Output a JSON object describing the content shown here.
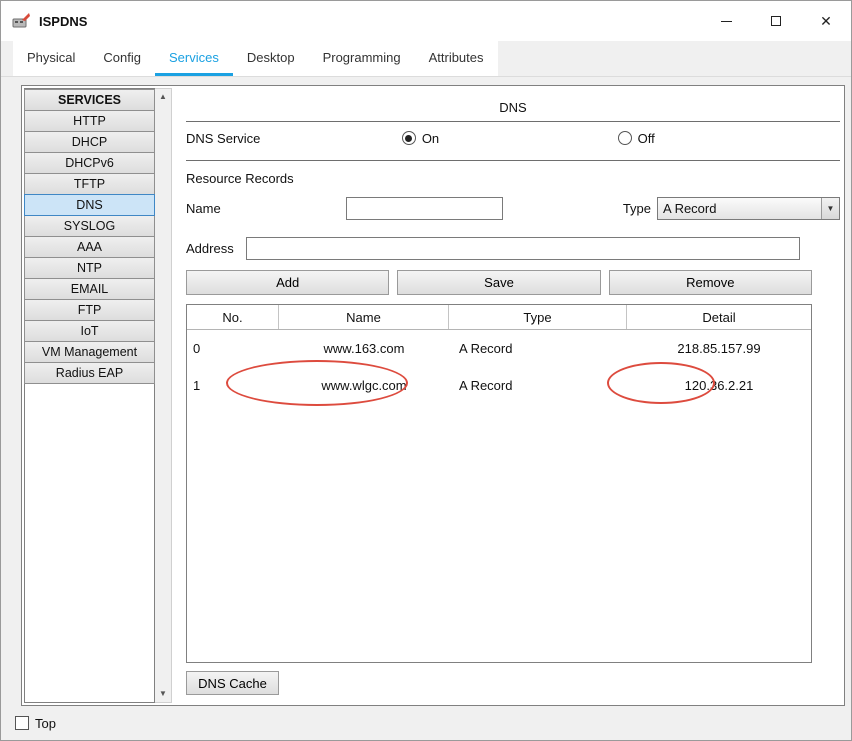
{
  "window": {
    "title": "ISPDNS"
  },
  "tabs": [
    {
      "label": "Physical",
      "active": false
    },
    {
      "label": "Config",
      "active": false
    },
    {
      "label": "Services",
      "active": true
    },
    {
      "label": "Desktop",
      "active": false
    },
    {
      "label": "Programming",
      "active": false
    },
    {
      "label": "Attributes",
      "active": false
    }
  ],
  "sidebar": {
    "header": "SERVICES",
    "items": [
      {
        "label": "HTTP"
      },
      {
        "label": "DHCP"
      },
      {
        "label": "DHCPv6"
      },
      {
        "label": "TFTP"
      },
      {
        "label": "DNS",
        "selected": true
      },
      {
        "label": "SYSLOG"
      },
      {
        "label": "AAA"
      },
      {
        "label": "NTP"
      },
      {
        "label": "EMAIL"
      },
      {
        "label": "FTP"
      },
      {
        "label": "IoT"
      },
      {
        "label": "VM Management"
      },
      {
        "label": "Radius EAP"
      }
    ]
  },
  "main": {
    "title": "DNS",
    "dns_service": {
      "label": "DNS Service",
      "on_label": "On",
      "off_label": "Off",
      "selected": "On"
    },
    "resource_records_label": "Resource Records",
    "name_label": "Name",
    "name_value": "",
    "type_label": "Type",
    "type_value": "A Record",
    "address_label": "Address",
    "address_value": "",
    "buttons": {
      "add": "Add",
      "save": "Save",
      "remove": "Remove"
    },
    "table": {
      "headers": [
        "No.",
        "Name",
        "Type",
        "Detail"
      ],
      "rows": [
        {
          "no": "0",
          "name": "www.163.com",
          "type": "A Record",
          "detail": "218.85.157.99"
        },
        {
          "no": "1",
          "name": "www.wlgc.com",
          "type": "A Record",
          "detail": "120.36.2.21",
          "annotated": true
        }
      ]
    },
    "dns_cache_button": "DNS Cache"
  },
  "footer": {
    "top_label": "Top"
  },
  "colors": {
    "accent": "#1ba1e2",
    "selected_item_bg": "#cce4f7",
    "annotation": "#dd4b3e"
  }
}
